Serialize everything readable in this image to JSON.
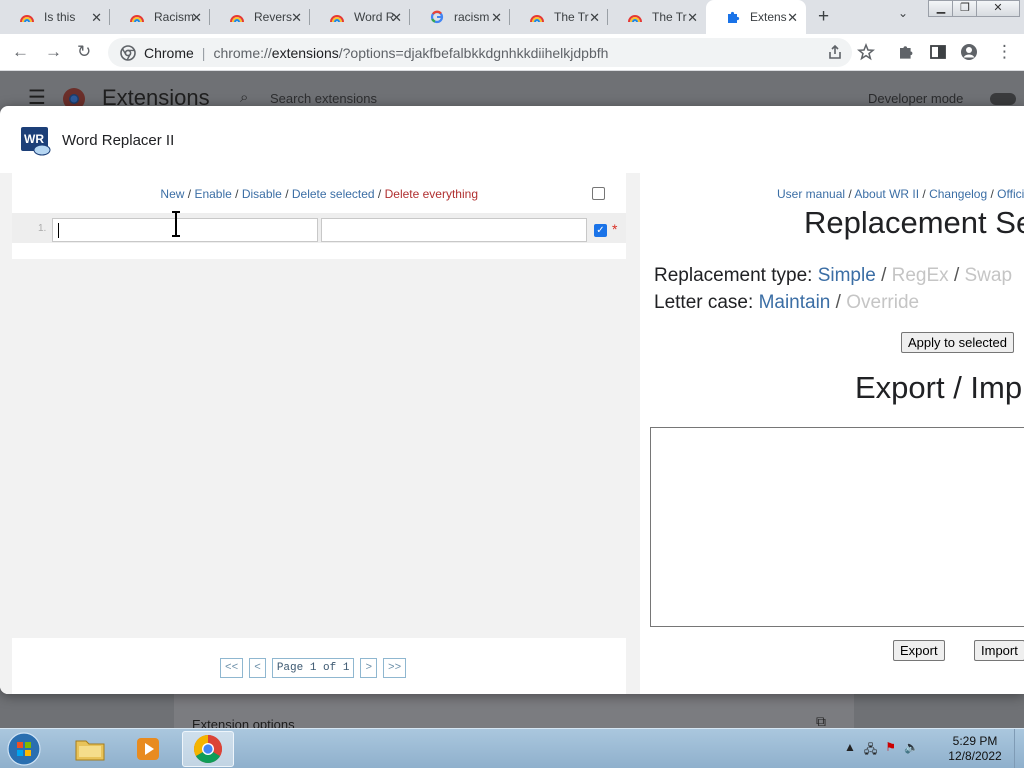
{
  "browser": {
    "tabs": [
      {
        "title": "Is this",
        "icon": "rainbow-favicon-icon"
      },
      {
        "title": "Racism",
        "icon": "rainbow-favicon-icon"
      },
      {
        "title": "Revers",
        "icon": "rainbow-favicon-icon"
      },
      {
        "title": "Word R",
        "icon": "rainbow-favicon-icon"
      },
      {
        "title": "racism",
        "icon": "google-g-icon"
      },
      {
        "title": "The Tr",
        "icon": "rainbow-favicon-icon"
      },
      {
        "title": "The Tr",
        "icon": "rainbow-favicon-icon"
      },
      {
        "title": "Extens",
        "icon": "puzzle-piece-icon",
        "active": true
      }
    ],
    "omnibox": {
      "site_label": "Chrome",
      "url_prefix": "chrome://",
      "url_host": "extensions",
      "url_rest": "/?options=djakfbefalbkkdgnhkkdiihelkjdpbfh"
    }
  },
  "extensions_page": {
    "title": "Extensions",
    "search_placeholder": "Search extensions",
    "developer_mode_label": "Developer mode",
    "extension_options_label": "Extension options"
  },
  "dialog": {
    "title": "Word Replacer II",
    "logo_text": "WR",
    "left": {
      "actions": {
        "new": "New",
        "enable": "Enable",
        "disable": "Disable",
        "delete_selected": "Delete selected",
        "delete_everything": "Delete everything",
        "separator": " / "
      },
      "rule": {
        "number": "1.",
        "find_value": "",
        "replace_value": "",
        "enabled": true,
        "marker": "*"
      },
      "pager": {
        "first": "<<",
        "prev": "<",
        "info": "Page 1 of 1",
        "next": ">",
        "last": ">>"
      }
    },
    "right": {
      "links": {
        "user_manual": "User manual",
        "about": "About WR II",
        "changelog": "Changelog",
        "official": "Offici"
      },
      "replacement_settings_title": "Replacement Se",
      "replacement_type": {
        "label": "Replacement type:",
        "simple": "Simple",
        "regex": "RegEx",
        "swap": "Swap"
      },
      "letter_case": {
        "label": "Letter case:",
        "maintain": "Maintain",
        "override": "Override"
      },
      "apply_button": "Apply to selected",
      "export_import_title": "Export / Imp",
      "export_textarea_value": "",
      "export_button": "Export",
      "import_button": "Import"
    }
  },
  "taskbar": {
    "clock_time": "5:29 PM",
    "clock_date": "12/8/2022"
  },
  "colors": {
    "link": "#3b6ea5",
    "danger": "#b03030",
    "disabled_option": "#c5c5c5",
    "checkbox_blue": "#1a73e8"
  }
}
